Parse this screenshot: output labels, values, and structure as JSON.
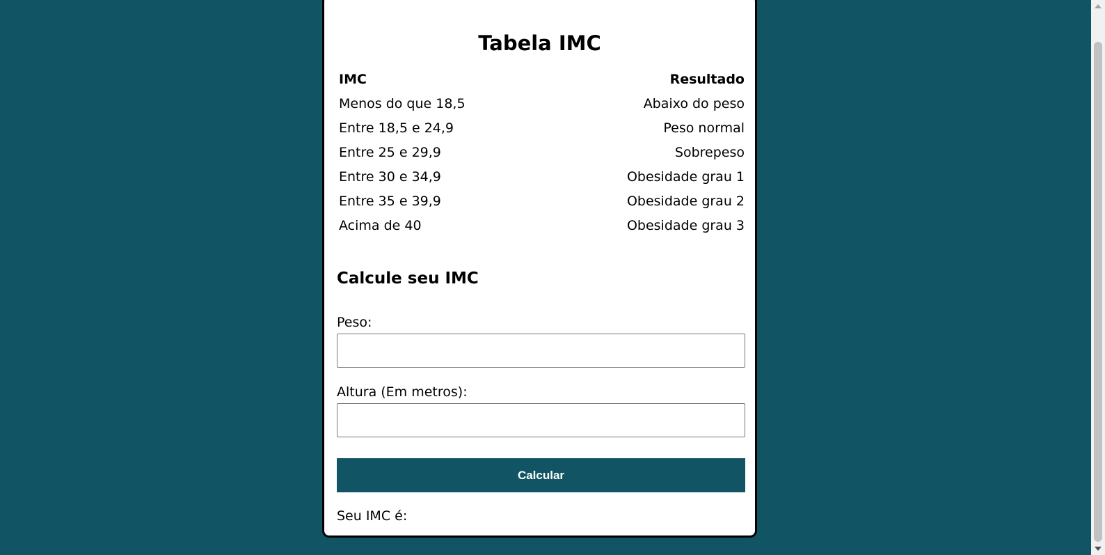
{
  "colors": {
    "background": "#115565",
    "card": "#ffffff",
    "button": "#115565",
    "button_text": "#ffffff"
  },
  "table": {
    "title": "Tabela IMC",
    "headers": {
      "imc": "IMC",
      "resultado": "Resultado"
    },
    "rows": [
      {
        "imc": "Menos do que 18,5",
        "resultado": "Abaixo do peso"
      },
      {
        "imc": "Entre 18,5 e 24,9",
        "resultado": "Peso normal"
      },
      {
        "imc": "Entre 25 e 29,9",
        "resultado": "Sobrepeso"
      },
      {
        "imc": "Entre 30 e 34,9",
        "resultado": "Obesidade grau 1"
      },
      {
        "imc": "Entre 35 e 39,9",
        "resultado": "Obesidade grau 2"
      },
      {
        "imc": "Acima de 40",
        "resultado": "Obesidade grau 3"
      }
    ]
  },
  "form": {
    "title": "Calcule seu IMC",
    "peso_label": "Peso:",
    "peso_value": "",
    "altura_label": "Altura (Em metros):",
    "altura_value": "",
    "button_label": "Calcular",
    "result_label": "Seu IMC é:"
  }
}
